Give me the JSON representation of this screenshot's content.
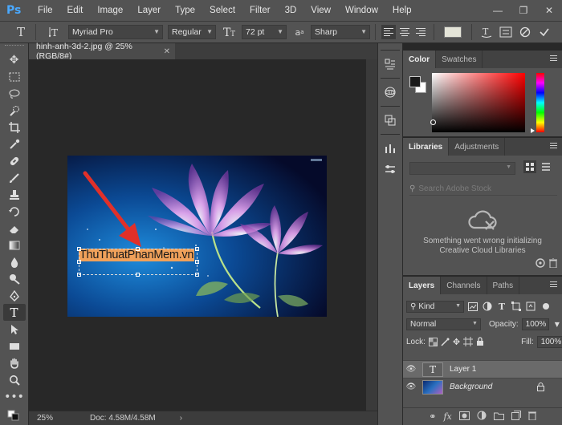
{
  "app": {
    "logo": "Ps"
  },
  "menu": [
    "File",
    "Edit",
    "Image",
    "Layer",
    "Type",
    "Select",
    "Filter",
    "3D",
    "View",
    "Window",
    "Help"
  ],
  "window_controls": [
    "—",
    "❐",
    "✕"
  ],
  "options": {
    "font_family": "Myriad Pro",
    "font_style": "Regular",
    "font_size": "72 pt",
    "aa_label": "a",
    "antialias": "Sharp"
  },
  "document": {
    "tab_title": "hinh-anh-3d-2.jpg @ 25% (RGB/8#)",
    "zoom": "25%",
    "doc_size": "Doc: 4.58M/4.58M",
    "text_layer_content": "ThuThuatPhanMem.vn"
  },
  "color_panel": {
    "tabs": [
      "Color",
      "Swatches"
    ],
    "hue": "#ff0000"
  },
  "libraries_panel": {
    "tabs": [
      "Libraries",
      "Adjustments"
    ],
    "search_placeholder": "Search Adobe Stock",
    "error_line1": "Something went wrong initializing",
    "error_line2": "Creative Cloud Libraries"
  },
  "layers_panel": {
    "tabs": [
      "Layers",
      "Channels",
      "Paths"
    ],
    "filter": "Kind",
    "blend_mode": "Normal",
    "opacity_label": "Opacity:",
    "opacity": "100%",
    "lock_label": "Lock:",
    "fill_label": "Fill:",
    "fill": "100%",
    "layers": [
      {
        "name": "Layer 1",
        "type": "text",
        "selected": true
      },
      {
        "name": "Background",
        "type": "image",
        "locked": true
      }
    ]
  },
  "colors": {
    "accent": "#4aa9ff",
    "highlight": "#f0a15a",
    "arrow": "#e0302a"
  }
}
